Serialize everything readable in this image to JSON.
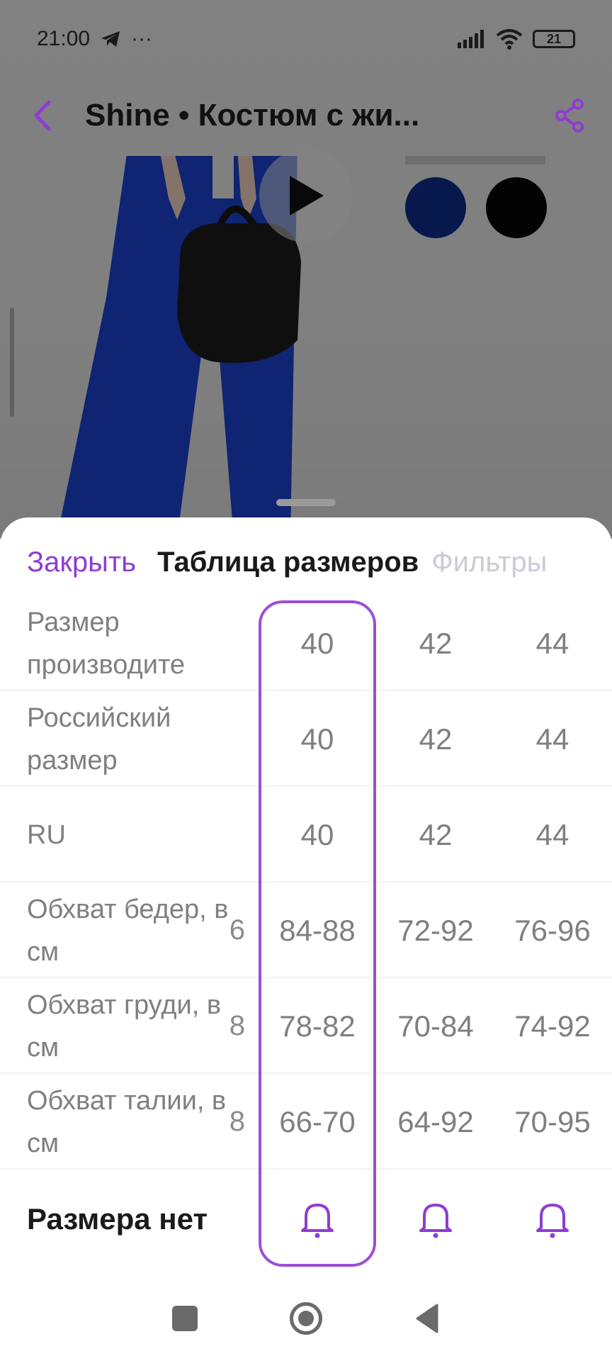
{
  "status_bar": {
    "time": "21:00",
    "dots": "···",
    "battery": "21"
  },
  "header": {
    "title": "Shine • Костюм с жи..."
  },
  "sheet": {
    "close_label": "Закрыть",
    "title": "Таблица размеров",
    "filters_label": "Фильтры"
  },
  "size_table": {
    "rows": [
      {
        "label": "Размер производите",
        "partial": "",
        "values": [
          "40",
          "42",
          "44"
        ]
      },
      {
        "label": "Российский размер",
        "partial": "",
        "values": [
          "40",
          "42",
          "44"
        ]
      },
      {
        "label": "RU",
        "partial": "",
        "values": [
          "40",
          "42",
          "44"
        ]
      },
      {
        "label": "Обхват бедер, в см",
        "partial": "6",
        "values": [
          "84-88",
          "72-92",
          "76-96"
        ]
      },
      {
        "label": "Обхват груди, в см",
        "partial": "8",
        "values": [
          "78-82",
          "70-84",
          "74-92"
        ]
      },
      {
        "label": "Обхват талии, в см",
        "partial": "8",
        "values": [
          "66-70",
          "64-92",
          "70-95"
        ]
      }
    ],
    "selected_size": "40",
    "notify_label": "Размера нет"
  },
  "colors": {
    "accent": "#8f3cd2",
    "swatches": [
      "#0b2a84",
      "#060606"
    ]
  }
}
